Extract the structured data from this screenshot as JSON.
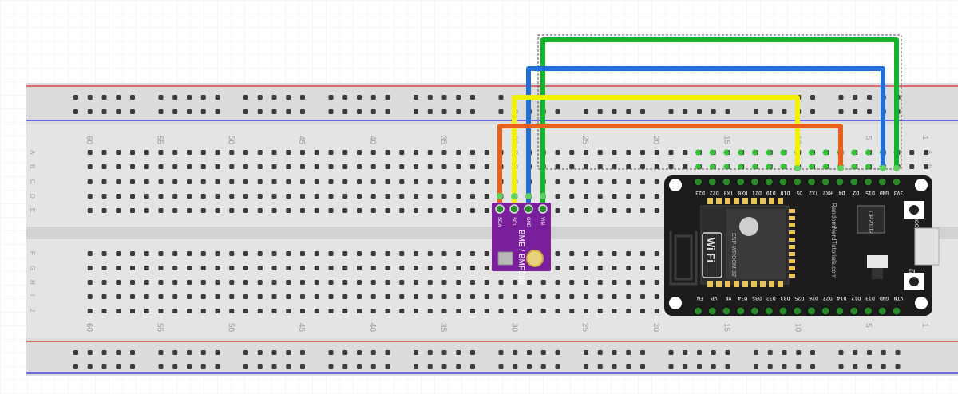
{
  "breadboard": {
    "column_numbers": [
      "60",
      "55",
      "50",
      "45",
      "40",
      "35",
      "30",
      "25",
      "20",
      "15",
      "10",
      "5",
      "1"
    ],
    "row_letters_top": [
      "A",
      "B",
      "C",
      "D",
      "E"
    ],
    "row_letters_bottom": [
      "F",
      "G",
      "H",
      "I",
      "J"
    ]
  },
  "colors": {
    "background": "#ffffff",
    "grid": "#e8e8e8",
    "breadboard": "#e6e6e6",
    "rail_red": "#d62828",
    "rail_blue": "#2a2ad6",
    "wire_orange": "#e8601c",
    "wire_yellow": "#f2f200",
    "wire_blue": "#1f6fd6",
    "wire_green": "#12b52a",
    "sensor_board": "#7a1f9c",
    "esp32_board": "#1c1c1c"
  },
  "sensor": {
    "label": "BME / BMP280",
    "pins": [
      "SDA",
      "SCL",
      "GND",
      "VIN"
    ]
  },
  "esp32": {
    "top_pins": [
      "3V3",
      "GND",
      "D15",
      "D2",
      "D4",
      "RX2",
      "TX2",
      "D5",
      "D18",
      "D19",
      "D21",
      "RX0",
      "TX0",
      "D22",
      "D23"
    ],
    "bottom_pins": [
      "VIN",
      "GND",
      "D13",
      "D12",
      "D14",
      "D27",
      "D26",
      "D25",
      "D33",
      "D32",
      "D35",
      "D34",
      "VN",
      "VP",
      "EN"
    ],
    "module_label": "ESP-WROOM-32",
    "wifi_label": "Wi Fi",
    "site_label": "RandomNerdTutorials.com",
    "chip_label": "CP2102",
    "boot_label": "BOOT",
    "en_label": "EN"
  },
  "wires": [
    {
      "name": "orange",
      "from": "SDA",
      "to": "D21"
    },
    {
      "name": "yellow",
      "from": "SCL",
      "to": "D22"
    },
    {
      "name": "blue",
      "from": "GND",
      "to": "GND"
    },
    {
      "name": "green",
      "from": "VIN",
      "to": "3V3"
    }
  ]
}
